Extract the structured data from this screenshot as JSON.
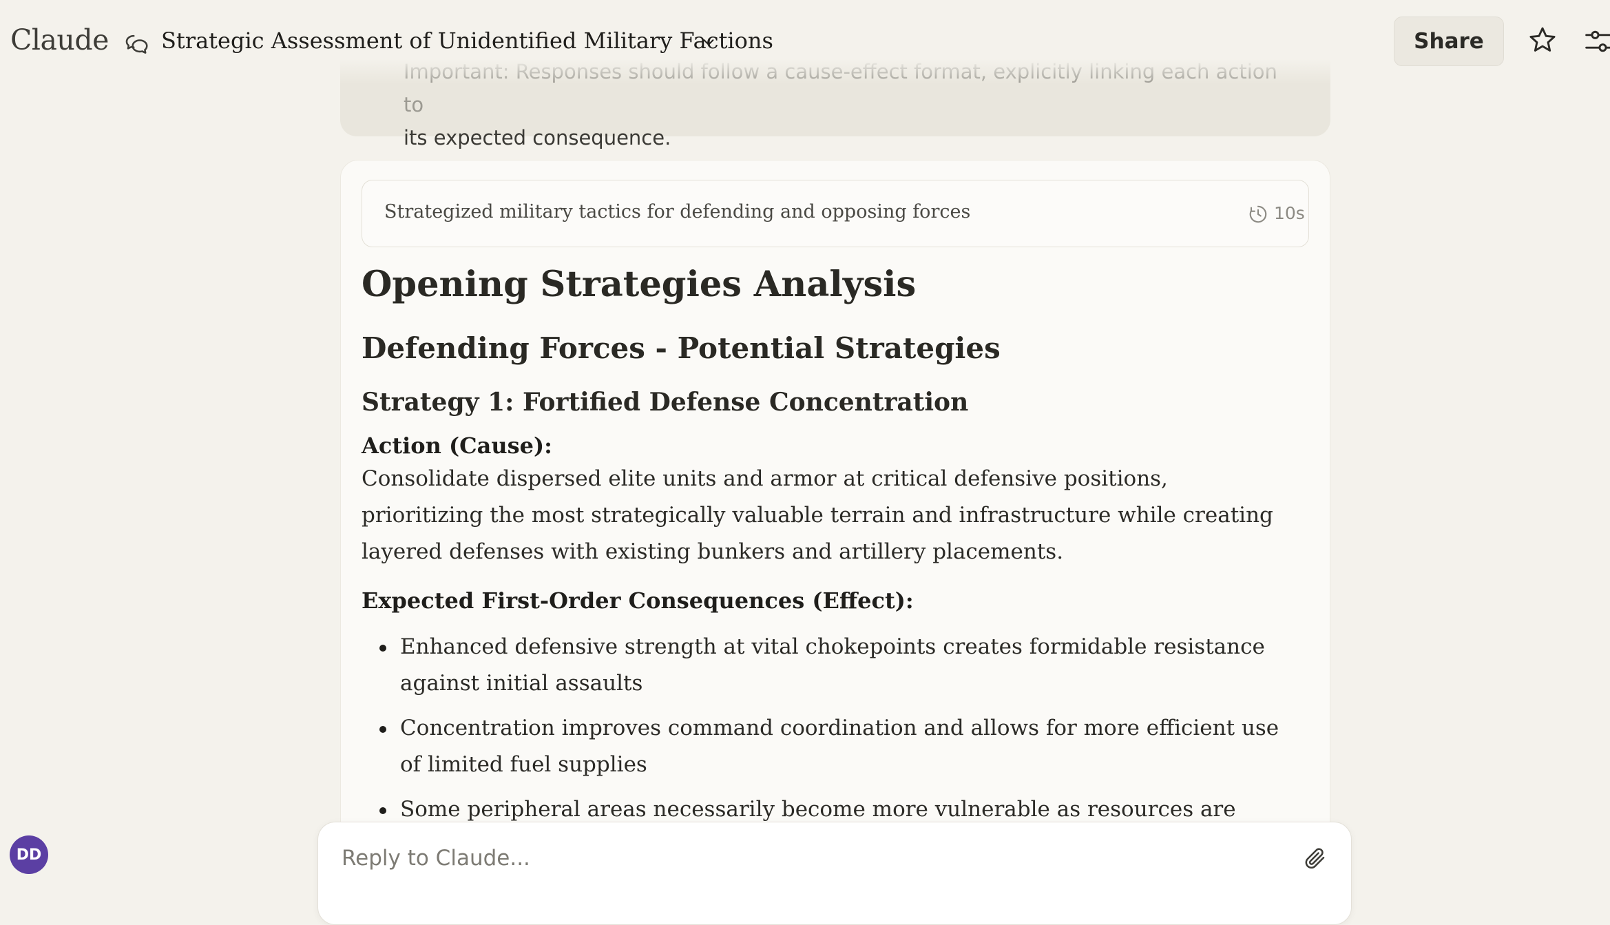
{
  "app": {
    "brand": "Claude"
  },
  "header": {
    "conversation_title": "Strategic Assessment of Unidentified Military Factions",
    "share_label": "Share"
  },
  "user_message": {
    "line1": "Important: Responses should follow a cause-effect format, explicitly linking each action to",
    "line2": "its expected consequence."
  },
  "response": {
    "thinking_summary": "Strategized military tactics for defending and opposing forces",
    "thinking_duration": "10s",
    "heading1": "Opening Strategies Analysis",
    "heading2": "Defending Forces - Potential Strategies",
    "heading3": "Strategy 1: Fortified Defense Concentration",
    "action_label": "Action (Cause):",
    "action_text": "Consolidate dispersed elite units and armor at critical defensive positions, prioritizing the most strategically valuable terrain and infrastructure while creating layered defenses with existing bunkers and artillery placements.",
    "effect_label": "Expected First-Order Consequences (Effect):",
    "bullets": [
      "Enhanced defensive strength at vital chokepoints creates formidable resistance against initial assaults",
      "Concentration improves command coordination and allows for more efficient use of limited fuel supplies",
      "Some peripheral areas necessarily become more vulnerable as resources are pulled to"
    ]
  },
  "composer": {
    "placeholder": "Reply to Claude..."
  },
  "user": {
    "initials": "DD"
  },
  "icons": {
    "chat": "chat-bubbles-icon",
    "chevron": "chevron-down-icon",
    "star": "star-icon",
    "settings": "sliders-icon",
    "timer": "timer-icon",
    "attach": "paperclip-icon"
  },
  "colors": {
    "background": "#f4f2ec",
    "card": "#fbfaf7",
    "avatar": "#5b3fa3"
  }
}
